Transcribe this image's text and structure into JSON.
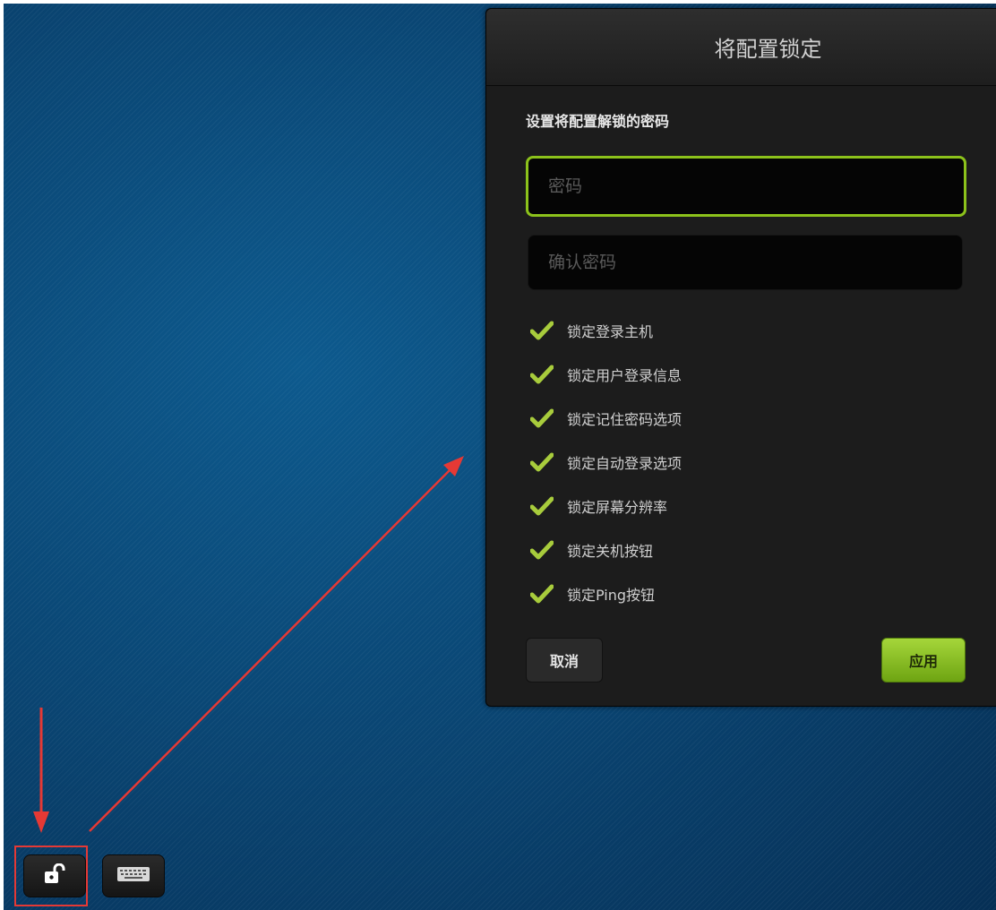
{
  "dialog": {
    "title": "将配置锁定",
    "prompt": "设置将配置解锁的密码",
    "password_placeholder": "密码",
    "confirm_placeholder": "确认密码",
    "options": [
      {
        "label": "锁定登录主机",
        "checked": true
      },
      {
        "label": "锁定用户登录信息",
        "checked": true
      },
      {
        "label": "锁定记住密码选项",
        "checked": true
      },
      {
        "label": "锁定自动登录选项",
        "checked": true
      },
      {
        "label": "锁定屏幕分辨率",
        "checked": true
      },
      {
        "label": "锁定关机按钮",
        "checked": true
      },
      {
        "label": "锁定Ping按钮",
        "checked": true
      }
    ],
    "cancel_label": "取消",
    "apply_label": "应用"
  },
  "taskbar": {
    "lock_icon": "unlock-icon",
    "keyboard_icon": "keyboard-icon"
  },
  "colors": {
    "accent": "#8cc21b",
    "annotation": "#e53935"
  }
}
